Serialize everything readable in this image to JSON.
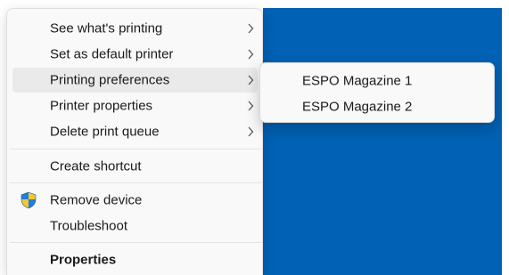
{
  "context_menu": {
    "items": [
      {
        "label": "See what's printing",
        "has_submenu": true
      },
      {
        "label": "Set as default printer",
        "has_submenu": true
      },
      {
        "label": "Printing preferences",
        "has_submenu": true,
        "highlighted": true
      },
      {
        "label": "Printer properties",
        "has_submenu": true
      },
      {
        "label": "Delete print queue",
        "has_submenu": true
      },
      {
        "label": "Create shortcut",
        "has_submenu": false
      },
      {
        "label": "Remove device",
        "has_submenu": false,
        "icon": "uac-shield-icon"
      },
      {
        "label": "Troubleshoot",
        "has_submenu": false
      },
      {
        "label": "Properties",
        "has_submenu": false,
        "bold": true
      }
    ]
  },
  "submenu": {
    "items": [
      {
        "label": "ESPO Magazine 1"
      },
      {
        "label": "ESPO Magazine 2"
      }
    ]
  },
  "colors": {
    "desktop_background": "#0161b4",
    "menu_background": "#f9f9f9",
    "highlight": "#eaeaea",
    "shield_blue": "#1e7fd6",
    "shield_yellow": "#f7c531"
  }
}
